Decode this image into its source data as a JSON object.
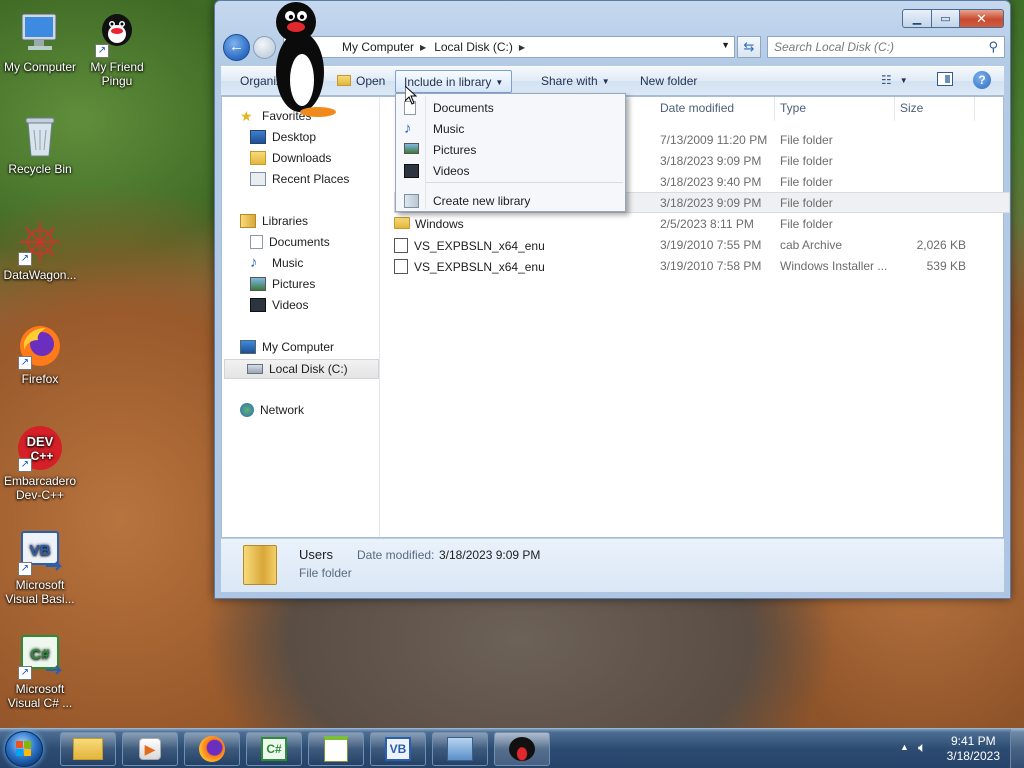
{
  "desktop": {
    "icons": [
      {
        "label": "My Computer"
      },
      {
        "label": "My Friend Pingu"
      },
      {
        "label": "Recycle Bin"
      },
      {
        "label": "DataWagon..."
      },
      {
        "label": "Firefox"
      },
      {
        "label": "Embarcadero Dev-C++"
      },
      {
        "label": "Microsoft Visual Basi..."
      },
      {
        "label": "Microsoft Visual C# ..."
      }
    ],
    "dev_badge_text": "DEV",
    "dev_badge_sub": "C++",
    "vb_badge_text": "VB",
    "cs_badge_text": "C#"
  },
  "window": {
    "address": {
      "crumbs": [
        "My Computer",
        "Local Disk (C:)"
      ]
    },
    "search_placeholder": "Search Local Disk (C:)",
    "toolbar": {
      "organize": "Organize",
      "open": "Open",
      "include_in_library": "Include in library",
      "share_with": "Share with",
      "new_folder": "New folder"
    },
    "nav_pane": {
      "favorites": "Favorites",
      "favorites_items": [
        "Desktop",
        "Downloads",
        "Recent Places"
      ],
      "libraries": "Libraries",
      "libraries_items": [
        "Documents",
        "Music",
        "Pictures",
        "Videos"
      ],
      "my_computer": "My Computer",
      "local_disk": "Local Disk (C:)",
      "network": "Network"
    },
    "columns": {
      "date_modified": "Date modified",
      "type": "Type",
      "size": "Size"
    },
    "files": [
      {
        "name": "",
        "date": "7/13/2009 11:20 PM",
        "type": "File folder",
        "size": ""
      },
      {
        "name": "",
        "date": "3/18/2023 9:09 PM",
        "type": "File folder",
        "size": ""
      },
      {
        "name": "",
        "date": "3/18/2023 9:40 PM",
        "type": "File folder",
        "size": ""
      },
      {
        "name": "",
        "date": "3/18/2023 9:09 PM",
        "type": "File folder",
        "size": ""
      },
      {
        "name": "Windows",
        "date": "2/5/2023 8:11 PM",
        "type": "File folder",
        "size": ""
      },
      {
        "name": "VS_EXPBSLN_x64_enu",
        "date": "3/19/2010 7:55 PM",
        "type": "cab Archive",
        "size": "2,026 KB"
      },
      {
        "name": "VS_EXPBSLN_x64_enu",
        "date": "3/19/2010 7:58 PM",
        "type": "Windows Installer ...",
        "size": "539 KB"
      }
    ],
    "details": {
      "name": "Users",
      "date_label": "Date modified:",
      "date_value": "3/18/2023 9:09 PM",
      "type": "File folder"
    }
  },
  "library_menu": {
    "items": [
      "Documents",
      "Music",
      "Pictures",
      "Videos"
    ],
    "create": "Create new library"
  },
  "taskbar": {
    "time": "9:41 PM",
    "date": "3/18/2023",
    "cs_label": "C#",
    "vb_label": "VB"
  },
  "colors": {
    "accent": "#2b6ac4",
    "folder": "#e3b53c"
  }
}
